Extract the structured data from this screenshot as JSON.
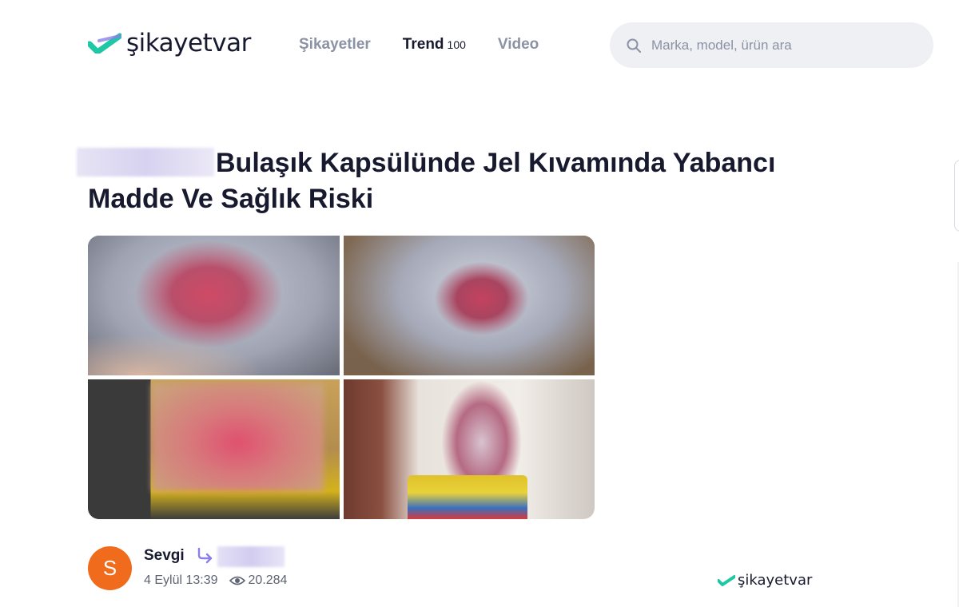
{
  "header": {
    "logo_text": "şikayetvar",
    "nav": [
      {
        "label": "Şikayetler",
        "badge": ""
      },
      {
        "label": "Trend",
        "badge": "100"
      },
      {
        "label": "Video",
        "badge": ""
      }
    ],
    "search_placeholder": "Marka, model, ürün ara"
  },
  "complaint": {
    "title": "Bulaşık Kapsülünde Jel Kıvamında Yabancı Madde Ve Sağlık Riski",
    "photos": [
      {
        "name": "photo-1"
      },
      {
        "name": "photo-2"
      },
      {
        "name": "photo-3"
      },
      {
        "name": "photo-4"
      }
    ]
  },
  "author": {
    "initial": "S",
    "name": "Sevgi",
    "date": "4 Eylül 13:39",
    "views": "20.284"
  },
  "watermark": "şikayetvar",
  "colors": {
    "brand_teal": "#1ec8a5",
    "avatar_orange": "#f06b1b",
    "text_dark": "#171a2e",
    "text_muted": "#8b92a3",
    "reply_purple": "#8b7fe8"
  }
}
